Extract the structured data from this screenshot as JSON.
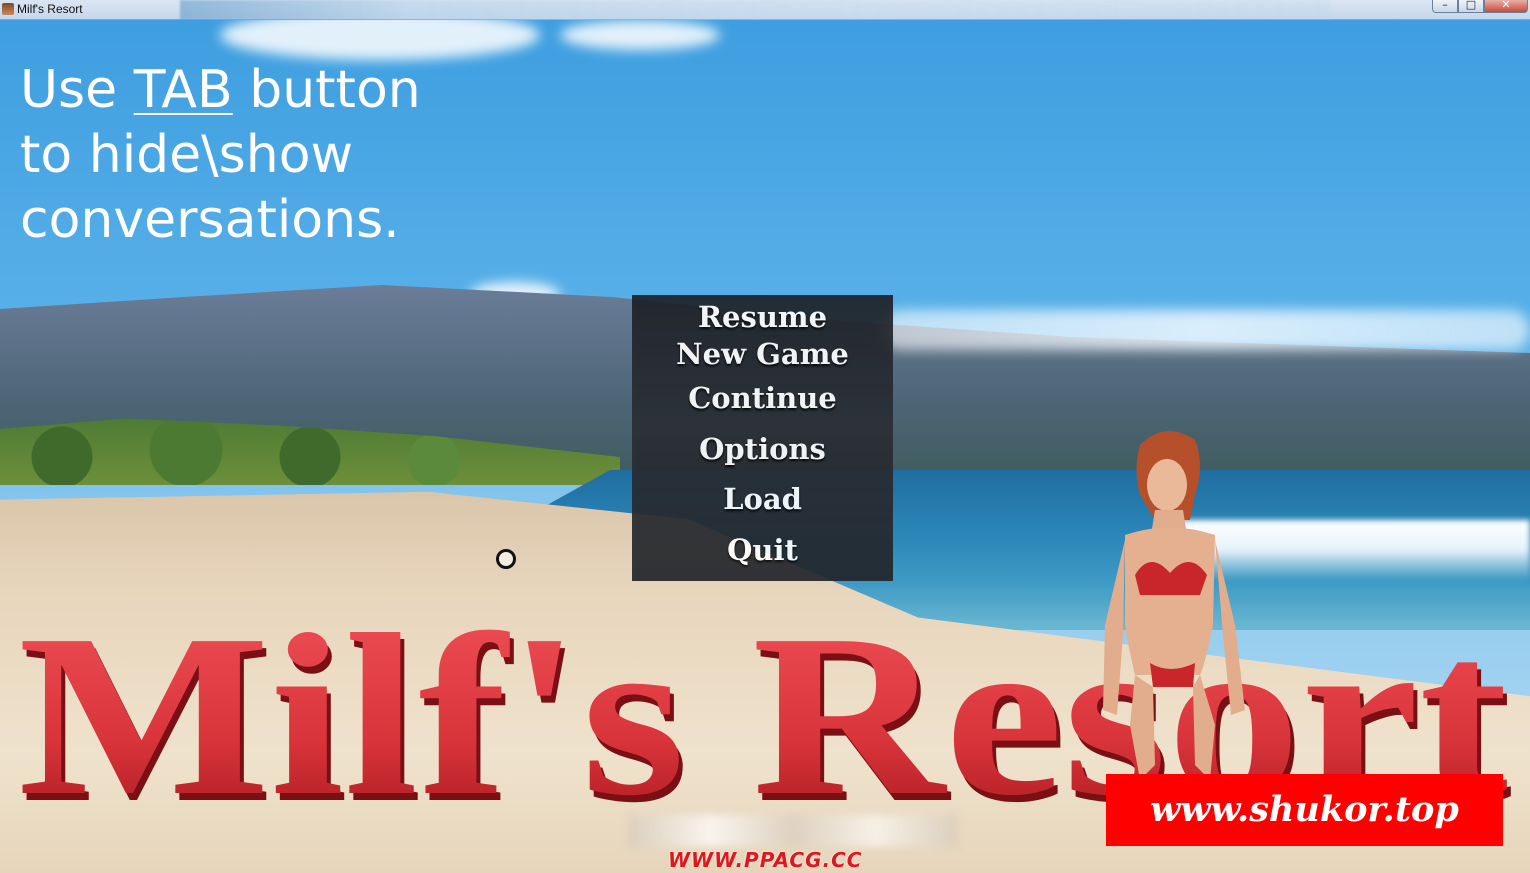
{
  "window": {
    "title": "Milf's Resort",
    "controls": {
      "minimize": "–",
      "maximize": "□",
      "close": "✕"
    }
  },
  "hint": {
    "line1_prefix": "Use ",
    "line1_key": "TAB",
    "line1_suffix": " button",
    "line2": "to hide\\show",
    "line3": "conversations."
  },
  "menu": {
    "items": [
      "Resume",
      "New Game",
      "Continue",
      "Options",
      "Load",
      "Quit"
    ]
  },
  "logo": {
    "text": "Milf's Resort",
    "color": "#d8343a"
  },
  "watermarks": {
    "site": "www.shukor.top",
    "ppacg": "WWW.PPACG.CC"
  },
  "colors": {
    "menu_bg": "#1d2127",
    "stamp": "#ff0000"
  }
}
